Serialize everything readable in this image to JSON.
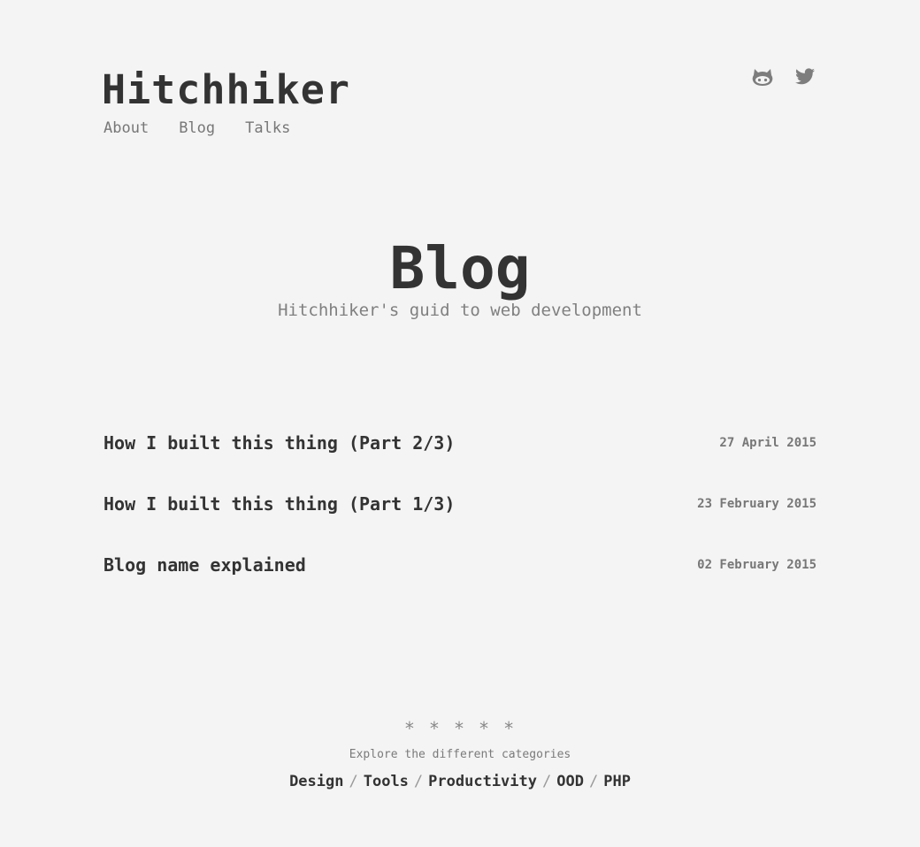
{
  "header": {
    "site_title": "Hitchhiker",
    "nav": [
      {
        "label": "About"
      },
      {
        "label": "Blog"
      },
      {
        "label": "Talks"
      }
    ],
    "social": [
      {
        "icon": "github-icon"
      },
      {
        "icon": "twitter-icon"
      }
    ]
  },
  "hero": {
    "title": "Blog",
    "subtitle": "Hitchhiker's guid to web development"
  },
  "posts": [
    {
      "title": "How I built this thing (Part 2/3)",
      "date": "27 April 2015"
    },
    {
      "title": "How I built this thing (Part 1/3)",
      "date": "23 February 2015"
    },
    {
      "title": "Blog name explained",
      "date": "02 February 2015"
    }
  ],
  "footer": {
    "stars": "* * * * *",
    "explore_text": "Explore the different categories",
    "categories": [
      "Design",
      "Tools",
      "Productivity",
      "OOD",
      "PHP"
    ],
    "separator": "/"
  },
  "colors": {
    "background": "#f4f4f4",
    "text": "#333333",
    "muted": "#777777"
  }
}
